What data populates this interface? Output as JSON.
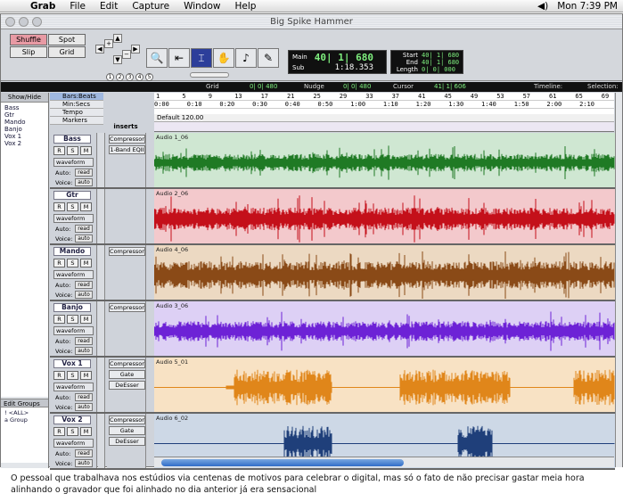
{
  "menubar": {
    "apple": "",
    "items": [
      "Grab",
      "File",
      "Edit",
      "Capture",
      "Window",
      "Help"
    ],
    "clock": "Mon 7:39 PM"
  },
  "window": {
    "title": "Big Spike Hammer"
  },
  "edit_modes": [
    {
      "label": "Shuffle",
      "active": true
    },
    {
      "label": "Spot",
      "active": false
    },
    {
      "label": "Slip",
      "active": false
    },
    {
      "label": "Grid",
      "active": false
    }
  ],
  "zoom_presets": [
    "1",
    "2",
    "3",
    "4",
    "5"
  ],
  "counter": {
    "main_label": "Main",
    "main_value": "40| 1| 680",
    "sub_label": "Sub",
    "sub_value": "1:18.353"
  },
  "selection": {
    "start_label": "Start",
    "start_value": "40| 1| 680",
    "end_label": "End",
    "end_value": "40| 1| 680",
    "length_label": "Length",
    "length_value": "0| 0| 000"
  },
  "gridbar": {
    "grid_label": "Grid",
    "grid_value": "0| 0| 480",
    "nudge_label": "Nudge",
    "nudge_value": "0| 0| 480",
    "cursor_label": "Cursor",
    "cursor_value": "41| 1| 606",
    "timeline_label": "Timeline:",
    "selection_label": "Selection:"
  },
  "left_panel": {
    "header": "Show/Hide",
    "tracks": [
      "Bass",
      "Gtr",
      "Mando",
      "Banjo",
      "Vox 1",
      "Vox 2"
    ],
    "groups_header": "Edit Groups",
    "groups": [
      "! <ALL>",
      "a Group"
    ]
  },
  "ruler_labels": [
    "Bars:Beats",
    "Min:Secs",
    "Tempo",
    "Markers"
  ],
  "inserts_header": "inserts",
  "bars": [
    "1",
    "5",
    "9",
    "13",
    "17",
    "21",
    "25",
    "29",
    "33",
    "37",
    "41",
    "45",
    "49",
    "53",
    "57",
    "61",
    "65",
    "69"
  ],
  "secs": [
    "0:00",
    "0:10",
    "0:20",
    "0:30",
    "0:40",
    "0:50",
    "1:00",
    "1:10",
    "1:20",
    "1:30",
    "1:40",
    "1:50",
    "2:00",
    "2:10"
  ],
  "tempo": "Default  120.00",
  "track_labels": {
    "r": "R",
    "s": "S",
    "m": "M",
    "waveform": "waveform",
    "auto_label": "Auto:",
    "voice_label": "Voice:",
    "read": "read",
    "auto": "auto"
  },
  "tracks": [
    {
      "name": "Bass",
      "region": "Audio 1_06",
      "inserts": [
        "Compressor",
        "1-Band EQII"
      ],
      "bg": "#cfe7d2",
      "wave": "#1f7a24"
    },
    {
      "name": "Gtr",
      "region": "Audio 2_06",
      "inserts": [],
      "bg": "#f3c9cc",
      "wave": "#c4101a"
    },
    {
      "name": "Mando",
      "region": "Audio 4_06",
      "inserts": [
        "Compressor"
      ],
      "bg": "#ecd9c2",
      "wave": "#8a4a17"
    },
    {
      "name": "Banjo",
      "region": "Audio 3_06",
      "inserts": [
        "Compressor"
      ],
      "bg": "#ddd0f5",
      "wave": "#6d22d6"
    },
    {
      "name": "Vox 1",
      "region": "Audio 5_01",
      "inserts": [
        "Compressor",
        "Gate",
        "DeEsser"
      ],
      "bg": "#f8e2c4",
      "wave": "#e0861a"
    },
    {
      "name": "Vox 2",
      "region": "Audio 6_02",
      "inserts": [
        "Compressor",
        "Gate",
        "DeEsser"
      ],
      "bg": "#cdd8e6",
      "wave": "#1f3f7a"
    }
  ],
  "caption": "O pessoal que trabalhava nos estúdios via centenas de motivos para celebrar o digital, mas só o fato de não precisar gastar meia hora alinhando o gravador que foi alinhado no dia anterior já era sensacional"
}
